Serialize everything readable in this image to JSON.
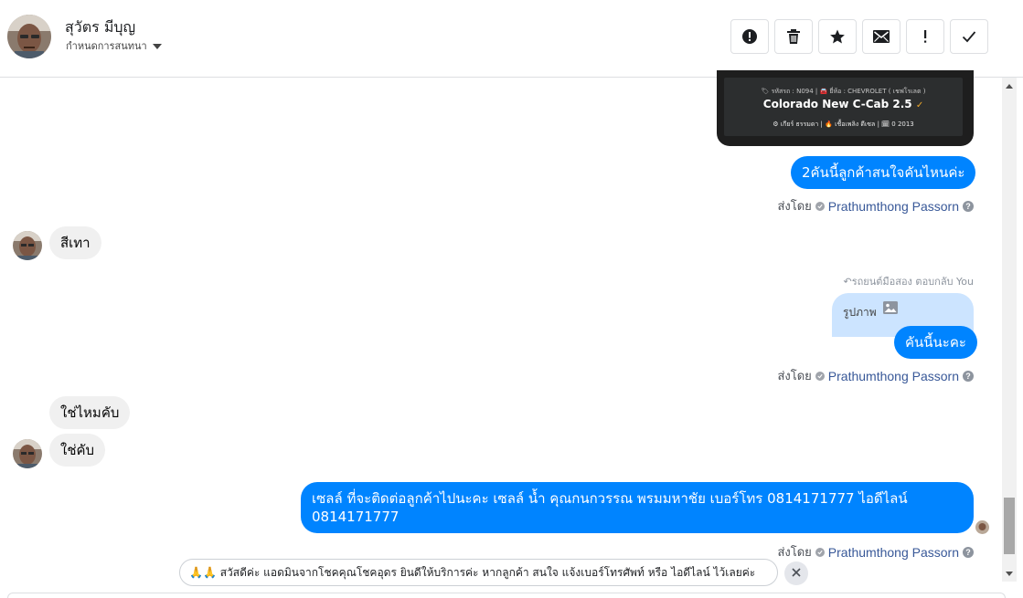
{
  "header": {
    "contact_name": "สุวัตร มีบุญ",
    "assign_label": "กำหนดการสนทนา",
    "toolbar": [
      {
        "name": "spam-button",
        "icon": "alert-circle-icon"
      },
      {
        "name": "delete-button",
        "icon": "trash-icon"
      },
      {
        "name": "star-button",
        "icon": "star-icon"
      },
      {
        "name": "mark-unread-button",
        "icon": "envelope-icon"
      },
      {
        "name": "follow-up-button",
        "icon": "exclamation-icon"
      },
      {
        "name": "mark-done-button",
        "icon": "check-icon"
      }
    ]
  },
  "car_card": {
    "meta": "🏷 รหัสรถ : N094 | 🚘 ยี่ห้อ : CHEVROLET ( เชฟโรเลต )",
    "model": "Colorado New C-Cab 2.5",
    "specs": "⚙ เกียร์ ธรรมดา   |   🔥 เชื้อเพลิง ดีเซล   |   🗓 0 2013"
  },
  "messages": {
    "m1": "2คันนี้ลูกค้าสนใจคันไหนค่ะ",
    "m2": "สีเทา",
    "m3_reply_label": "รถยนต์มือสอง ตอบกลับ You",
    "m3_quote": "รูปภาพ",
    "m3": "คันนี้นะคะ",
    "m4": "ใช่ไหมคับ",
    "m5": "ใช่คับ",
    "m6": "เซลล์ ที่จะติดต่อลูกค้าไปนะคะ เซลล์ น้ำ คุณกนกวรรณ พรมมหาชัย เบอร์โทร 0814171777 ไอดีไลน์ 0814171777"
  },
  "sent_by": {
    "prefix": "ส่งโดย",
    "sender": "Prathumthong Passorn"
  },
  "quick_reply": {
    "text": "🙏🙏 สวัสดีค่ะ แอดมินจากโชคคุณโชคอุดร ยินดีให้บริการค่ะ หากลูกค้า สนใจ แจ้งเบอร์โทรศัพท์ หรือ ไอดีไลน์ ไว้เลยค่ะ"
  },
  "colors": {
    "outgoing_bubble": "#0084ff",
    "incoming_bubble": "#f0f0f0",
    "reply_quote": "#cce4ff",
    "sender_link": "#385898"
  }
}
